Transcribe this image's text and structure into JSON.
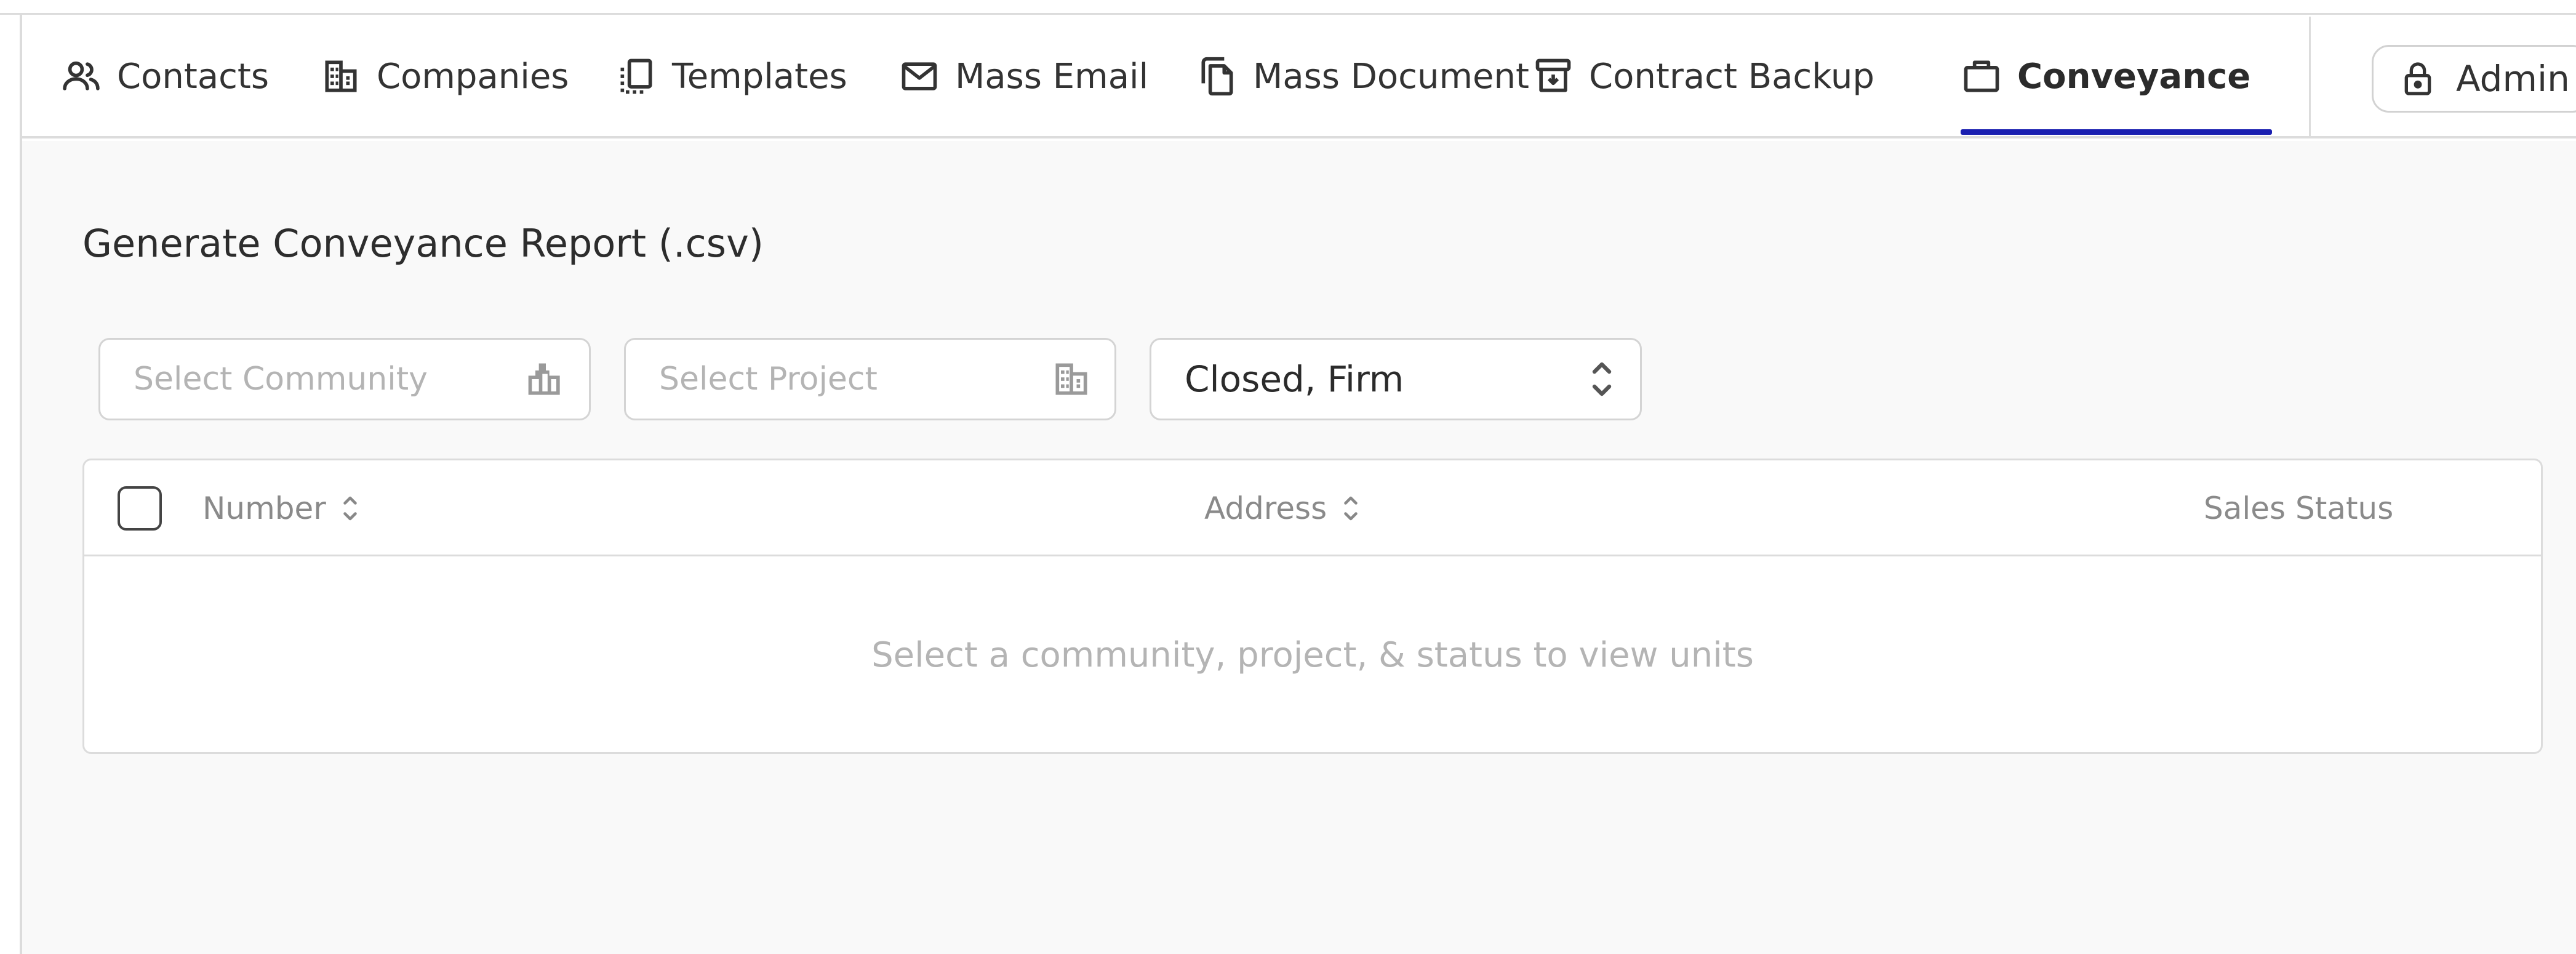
{
  "nav": {
    "tabs": [
      {
        "label": "Contacts",
        "icon": "people-icon"
      },
      {
        "label": "Companies",
        "icon": "building-icon"
      },
      {
        "label": "Templates",
        "icon": "template-icon"
      },
      {
        "label": "Mass Email",
        "icon": "mail-icon"
      },
      {
        "label": "Mass Document",
        "icon": "documents-icon"
      },
      {
        "label": "Contract Backup",
        "icon": "archive-icon"
      },
      {
        "label": "Conveyance",
        "icon": "briefcase-icon",
        "active": true
      }
    ],
    "admin_label": "Admin",
    "admin_icon": "lock-icon",
    "accent_color": "#1a1fb0"
  },
  "page": {
    "title": "Generate Conveyance Report (.csv)"
  },
  "filters": {
    "community": {
      "placeholder": "Select Community",
      "icon": "city-icon"
    },
    "project": {
      "placeholder": "Select Project",
      "icon": "building-icon"
    },
    "status": {
      "value": "Closed, Firm",
      "icon": "chevron-up-down-icon"
    }
  },
  "table": {
    "columns": [
      {
        "label": "Number",
        "sortable": true
      },
      {
        "label": "Address",
        "sortable": true
      },
      {
        "label": "Sales Status",
        "sortable": false
      }
    ],
    "empty_message": "Select a community, project, & status to view units"
  }
}
